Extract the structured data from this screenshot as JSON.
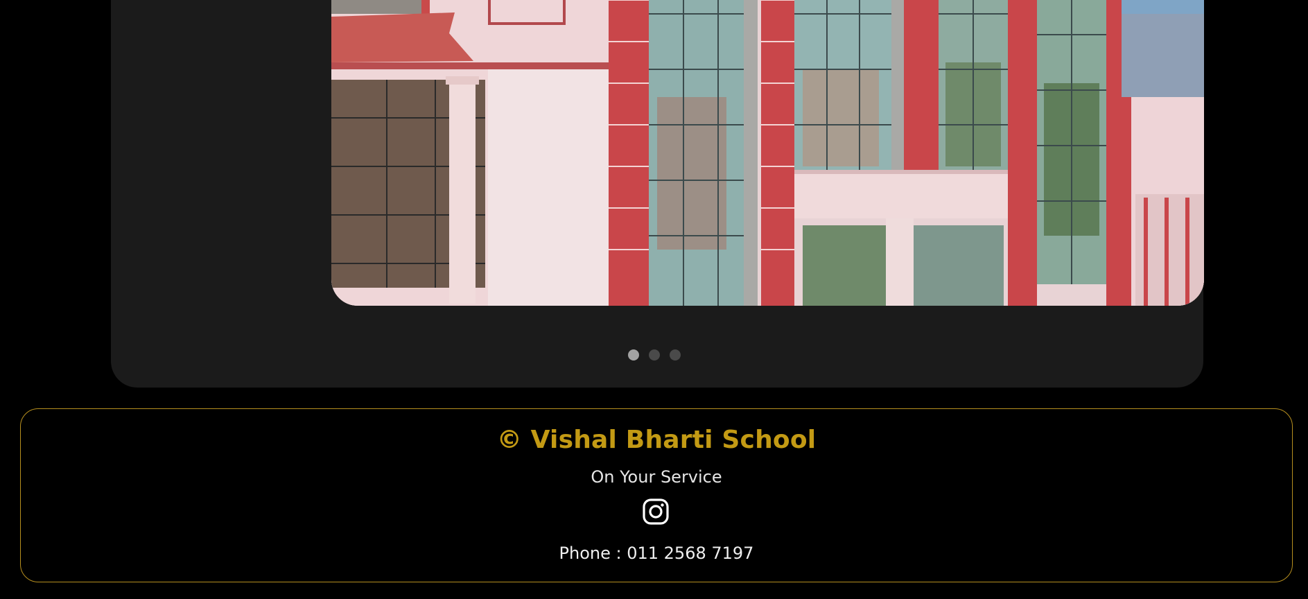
{
  "carousel": {
    "image_description_icon": "school-building-photo",
    "dots": [
      {
        "active": true
      },
      {
        "active": false
      },
      {
        "active": false
      }
    ]
  },
  "footer": {
    "title": "© Vishal Bharti School",
    "tagline": "On Your Service",
    "social_icon": "instagram-icon",
    "phone": "Phone : 011 2568 7197",
    "accent_color": "#c39a14",
    "border_color": "#b8901f"
  }
}
